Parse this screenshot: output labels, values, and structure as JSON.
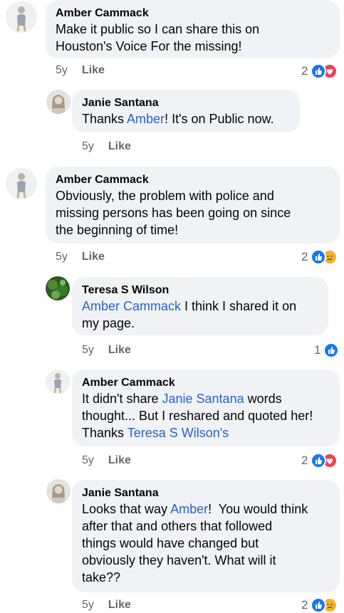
{
  "comments": [
    {
      "author": "Amber Cammack",
      "text_parts": [
        "Make it public so I can share this on",
        "Houston's Voice For the missing!"
      ],
      "time": "5y",
      "like": "Like",
      "reaction_count": "2",
      "reactions": [
        "like",
        "love"
      ]
    },
    {
      "author": "Janie Santana",
      "text_before": "Thanks ",
      "mention": "Amber",
      "text_after": "! It's on Public now.",
      "time": "5y",
      "like": "Like"
    },
    {
      "author": "Amber Cammack",
      "lines": [
        "Obviously, the problem with police and",
        "missing persons has been going on since",
        "the beginning of time!"
      ],
      "time": "5y",
      "like": "Like",
      "reaction_count": "2",
      "reactions": [
        "like",
        "sad"
      ]
    },
    {
      "author": "Teresa S Wilson",
      "mention": "Amber Cammack",
      "text_after": " I think I shared it on",
      "line2": "my page.",
      "time": "5y",
      "like": "Like",
      "reaction_count": "1",
      "reactions": [
        "like"
      ]
    },
    {
      "author": "Amber Cammack",
      "line1_before": "It didn't share ",
      "line1_mention": "Janie Santana",
      "line1_after": " words",
      "line2": "thought... But I reshared and quoted her!",
      "line3_before": "Thanks ",
      "line3_mention": "Teresa S Wilson's",
      "time": "5y",
      "like": "Like",
      "reaction_count": "2",
      "reactions": [
        "like",
        "love"
      ]
    },
    {
      "author": "Janie Santana",
      "line1_before": "Looks that way ",
      "line1_mention": "Amber",
      "line1_after": "!  You would think",
      "lines": [
        "after that and others that followed",
        "things would have changed but",
        "obviously they haven't. What will it",
        "take??"
      ],
      "time": "5y",
      "like": "Like",
      "reaction_count": "2",
      "reactions": [
        "like",
        "sad"
      ]
    }
  ],
  "colors": {
    "link": "#2a63c8",
    "bubble": "#f0f2f5",
    "like": "#1877f2",
    "love": "#f33e58",
    "sad": "#f7b125"
  }
}
